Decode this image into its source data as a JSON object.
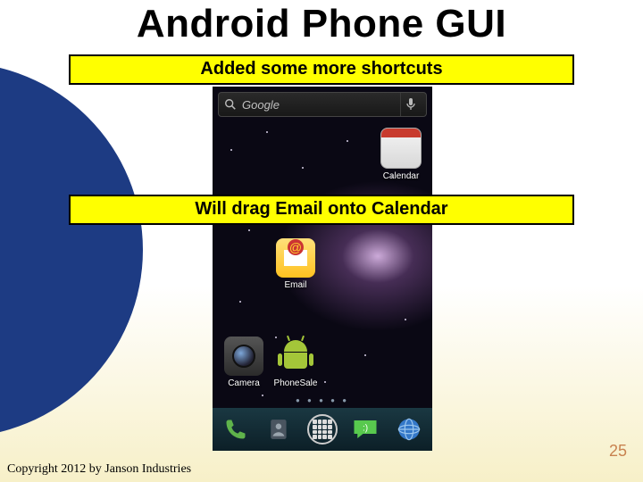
{
  "slide": {
    "title": "Android Phone GUI",
    "callout_top": "Added some more shortcuts",
    "callout_mid": "Will drag Email onto Calendar",
    "copyright": "Copyright 2012 by Janson Industries",
    "page_number": "25"
  },
  "phone": {
    "search_placeholder": "Google",
    "icons": {
      "calendar": "Calendar",
      "email": "Email",
      "camera": "Camera",
      "phonesale": "PhoneSale"
    },
    "dock": {
      "phone": "Phone",
      "contacts": "Contacts",
      "apps": "Apps",
      "messaging": "Messaging",
      "browser": "Browser"
    }
  }
}
